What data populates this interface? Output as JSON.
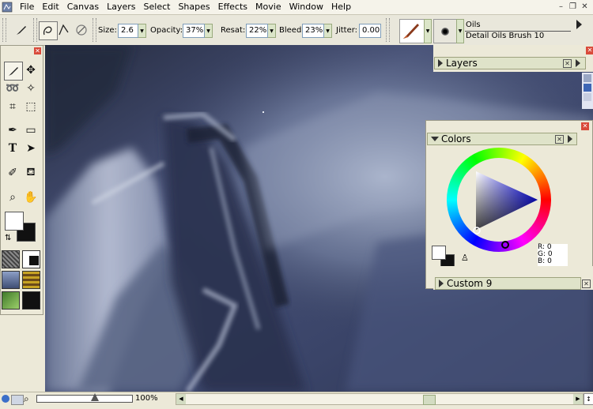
{
  "menubar": {
    "items": [
      "File",
      "Edit",
      "Canvas",
      "Layers",
      "Select",
      "Shapes",
      "Effects",
      "Movie",
      "Window",
      "Help"
    ]
  },
  "propbar": {
    "size_label": "Size:",
    "size_value": "2.6",
    "opacity_label": "Opacity:",
    "opacity_value": "37%",
    "resat_label": "Resat:",
    "resat_value": "22%",
    "bleed_label": "Bleed:",
    "bleed_value": "23%",
    "jitter_label": "Jitter:",
    "jitter_value": "0.00",
    "brush_category": "Oils",
    "brush_variant": "Detail Oils Brush 10"
  },
  "layers_panel": {
    "title": "Layers"
  },
  "colors_panel": {
    "title": "Colors",
    "r_label": "R: 0",
    "g_label": "G: 0",
    "b_label": "B: 0"
  },
  "custom_panel": {
    "title": "Custom 9"
  },
  "statusbar": {
    "zoom": "100%"
  },
  "colors": {
    "canvas_dark": "#3e4863",
    "canvas_light": "#c9d0de",
    "panel_bg": "#ece9d8",
    "panel_title": "#dfe3c9",
    "close_red": "#d94a3a"
  }
}
